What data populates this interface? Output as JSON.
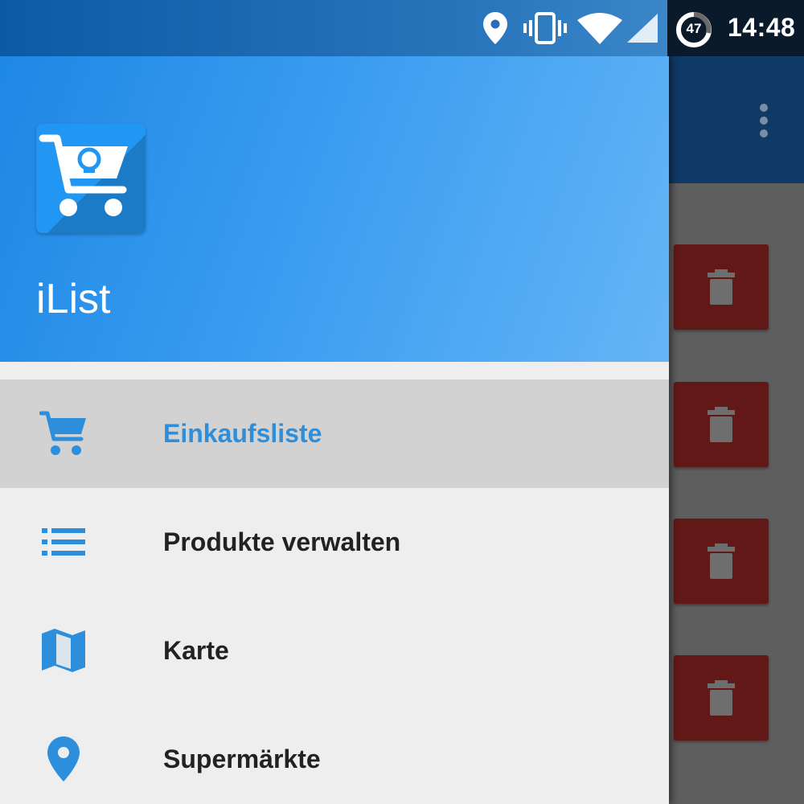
{
  "status_bar": {
    "battery_level": "47",
    "time": "14:48",
    "icons": [
      "location-icon",
      "vibrate-icon",
      "wifi-icon",
      "cell-signal-icon",
      "battery-saver-icon"
    ]
  },
  "drawer": {
    "app_name": "iList",
    "logo_icon": "shopping-cart-lightbulb-icon",
    "menu": [
      {
        "label": "Einkaufsliste",
        "icon": "shopping-cart-icon",
        "selected": true
      },
      {
        "label": "Produkte verwalten",
        "icon": "list-icon",
        "selected": false
      },
      {
        "label": "Karte",
        "icon": "map-icon",
        "selected": false
      },
      {
        "label": "Supermärkte",
        "icon": "location-pin-icon",
        "selected": false
      }
    ]
  },
  "background": {
    "toolbar_icon": "overflow-menu-icon",
    "row_action_icon": "trash-icon",
    "row_count": 4
  },
  "colors": {
    "accent": "#2d8fdc",
    "header_gradient_start": "#1e88e5",
    "header_gradient_end": "#64b5f6",
    "delete_button": "#631818",
    "selected_row": "#d2d2d2"
  }
}
